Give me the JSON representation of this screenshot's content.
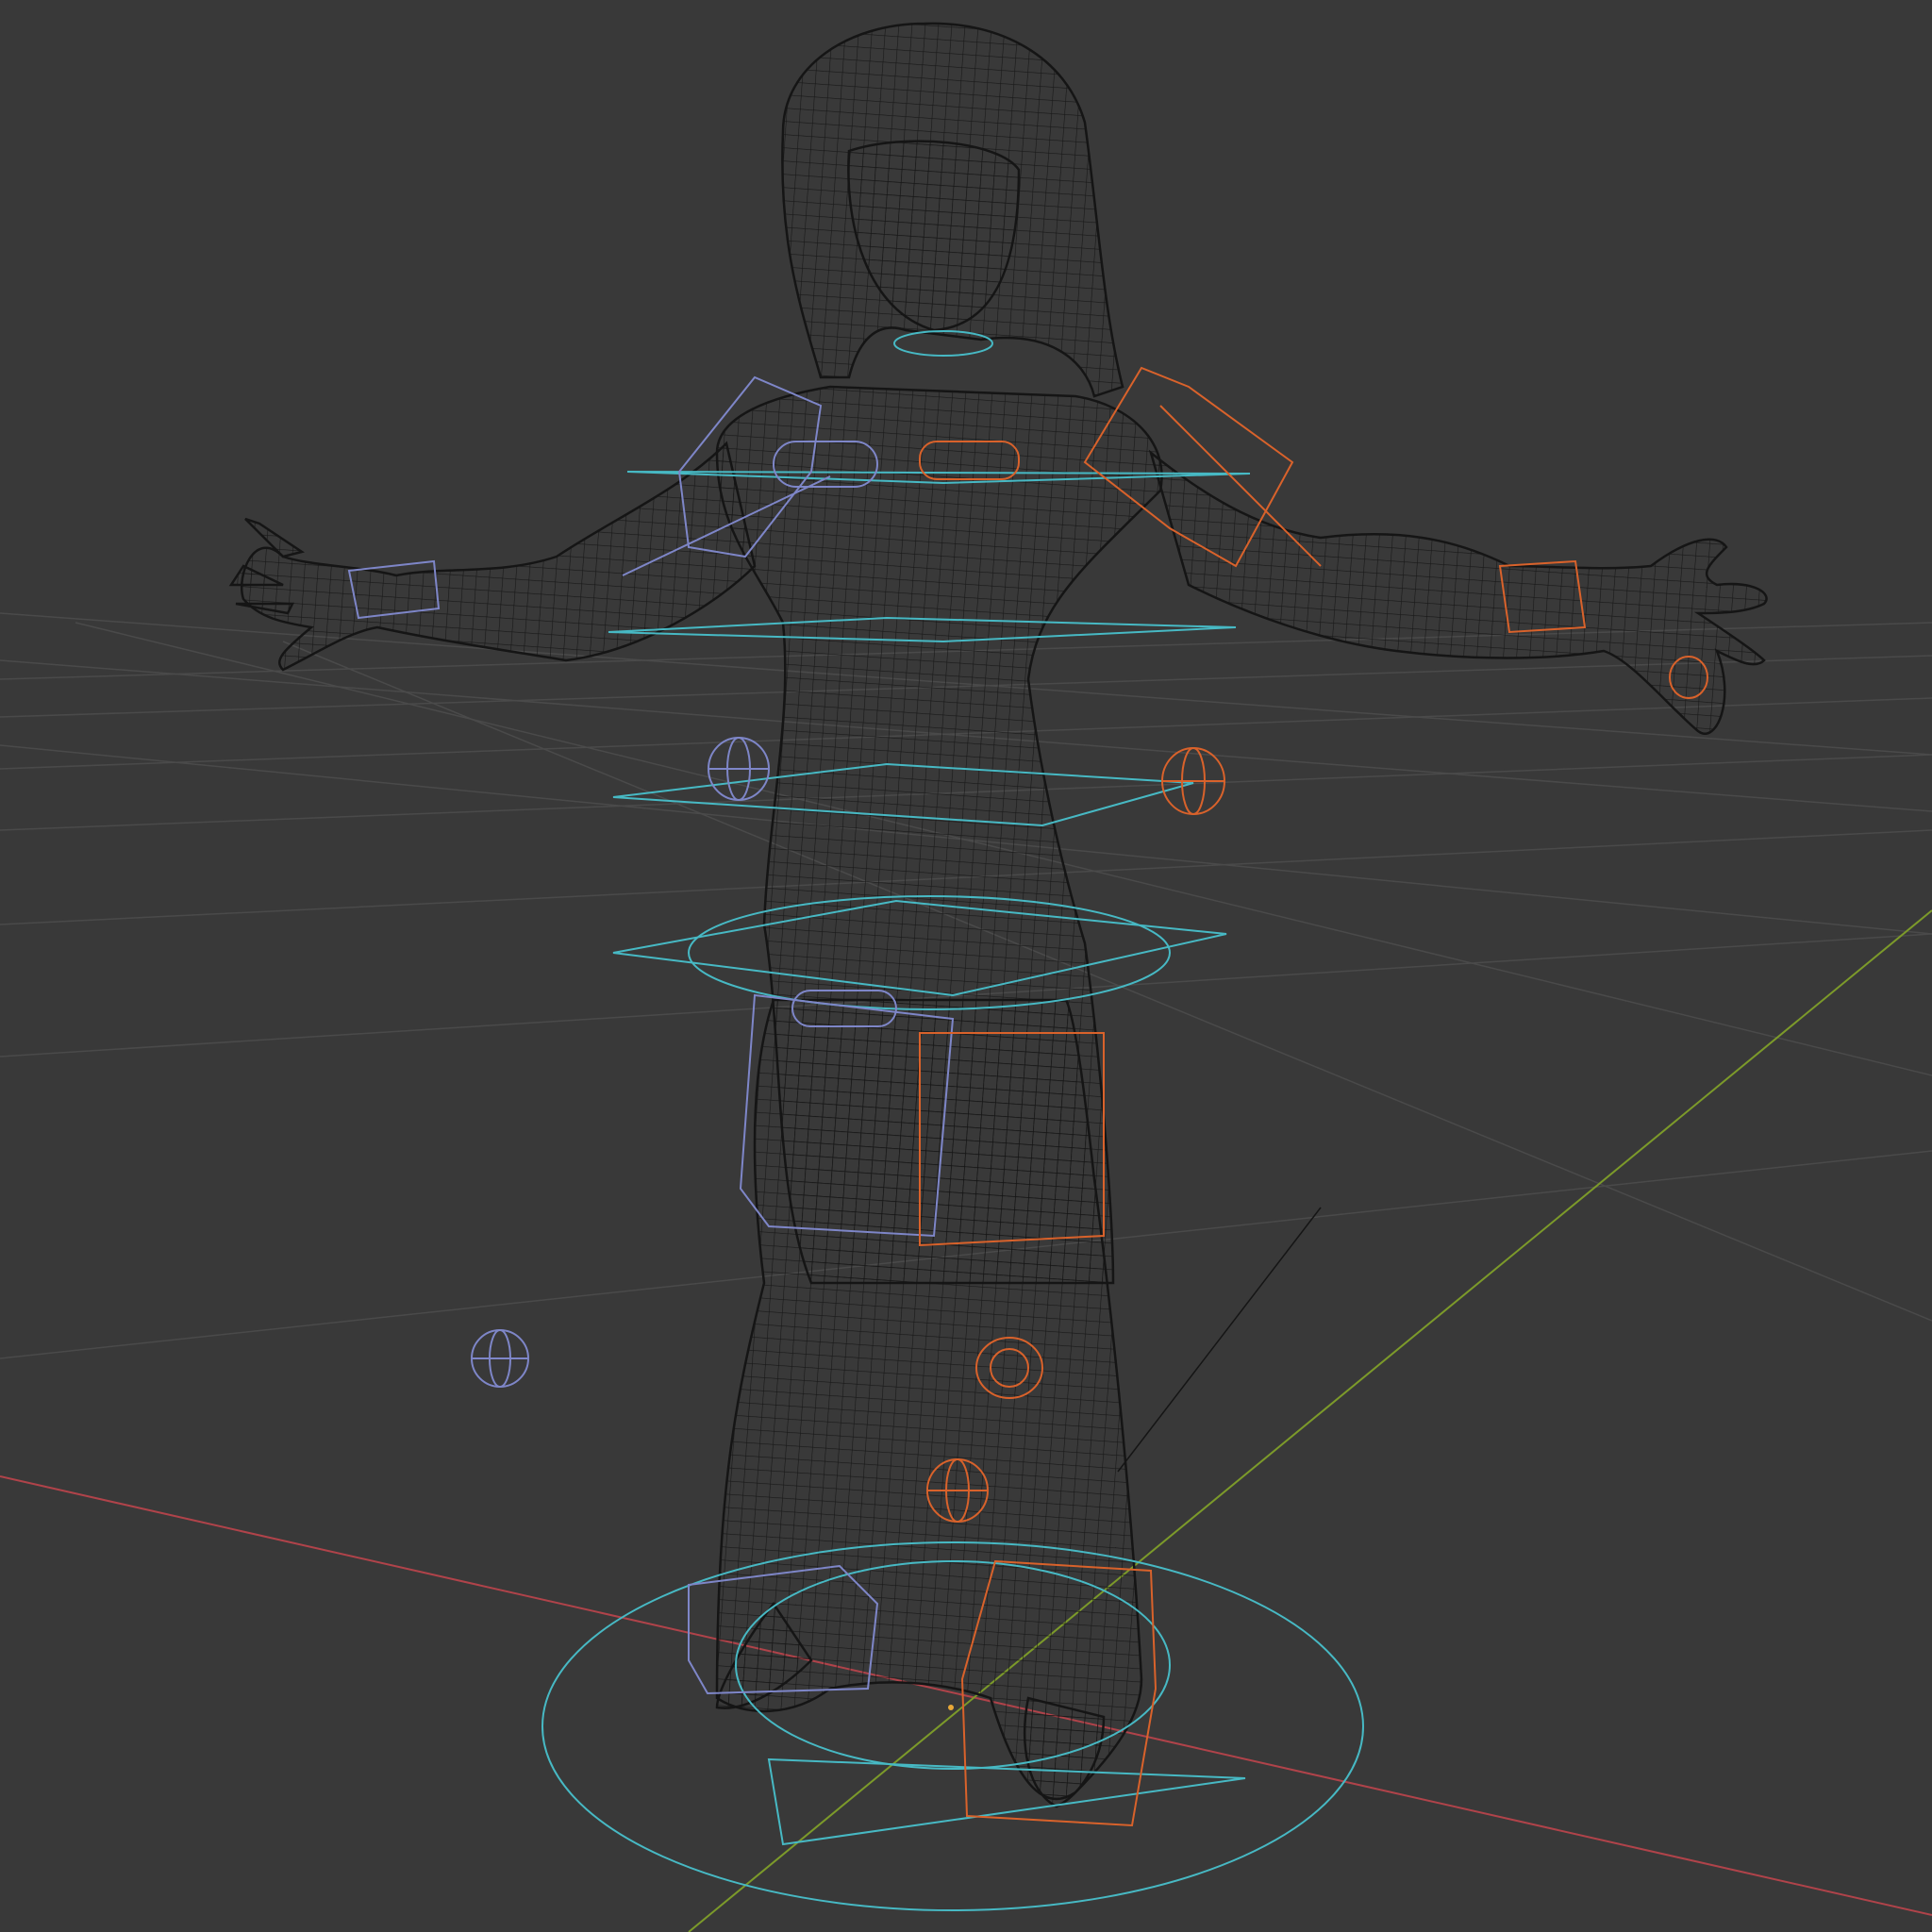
{
  "viewport": {
    "background": "#393939",
    "mode": "wireframe",
    "view": "perspective"
  },
  "colors": {
    "grid": "#4a4a4a",
    "x_axis": "#b0434a",
    "y_axis": "#7c9a2a",
    "mesh": "#151515",
    "control_main": "#47b9c4",
    "control_left": "#7e86c8",
    "control_right": "#d9622b"
  },
  "scene": {
    "object": "character-mesh",
    "pose": "T-pose",
    "rig_controls": [
      "root-circle-control",
      "hips-control",
      "spine-control",
      "chest-control",
      "neck-control",
      "shoulder-control-left",
      "shoulder-control-right",
      "upper-arm-box-left",
      "upper-arm-box-right",
      "hand-box-left",
      "hand-box-right",
      "elbow-pole-target-left",
      "elbow-pole-target-right",
      "thigh-box-left",
      "thigh-box-right",
      "knee-pole-target-left",
      "knee-pole-target-right",
      "foot-box-left",
      "foot-box-right"
    ]
  }
}
